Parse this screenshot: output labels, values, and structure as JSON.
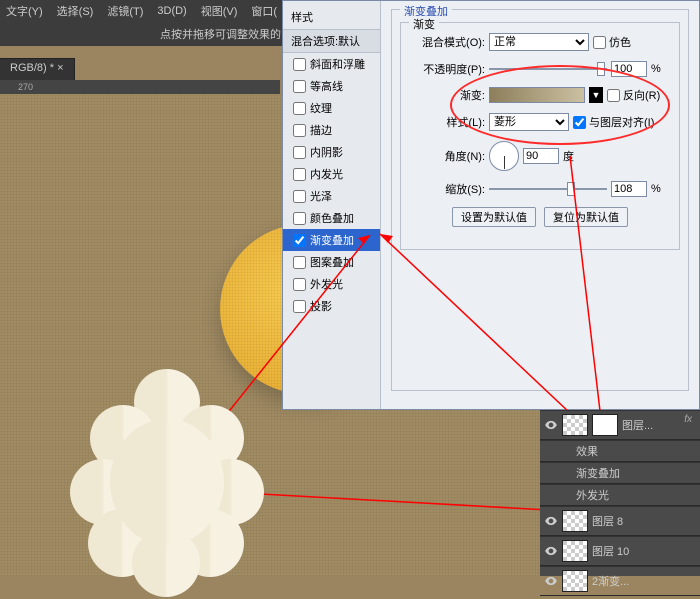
{
  "menubar": {
    "items": [
      "文字(Y)",
      "选择(S)",
      "滤镜(T)",
      "3D(D)",
      "视图(V)",
      "窗口("
    ]
  },
  "options_hint": "点按并拖移可调整效果的",
  "doc_tab": "RGB/8) * ×",
  "ruler": {
    "ticks": [
      "270"
    ]
  },
  "dialog": {
    "styles_title": "样式",
    "blend_title": "混合选项:默认",
    "items": [
      {
        "label": "斜面和浮雕",
        "checked": false
      },
      {
        "label": "等高线",
        "checked": false
      },
      {
        "label": "纹理",
        "checked": false
      },
      {
        "label": "描边",
        "checked": false
      },
      {
        "label": "内阴影",
        "checked": false
      },
      {
        "label": "内发光",
        "checked": false
      },
      {
        "label": "光泽",
        "checked": false
      },
      {
        "label": "颜色叠加",
        "checked": false
      },
      {
        "label": "渐变叠加",
        "checked": true,
        "selected": true
      },
      {
        "label": "图案叠加",
        "checked": false
      },
      {
        "label": "外发光",
        "checked": false
      },
      {
        "label": "投影",
        "checked": false
      }
    ],
    "group_title": "渐变叠加",
    "sub_title": "渐变",
    "blend_mode_label": "混合模式(O):",
    "blend_mode_value": "正常",
    "dither_label": "仿色",
    "opacity_label": "不透明度(P):",
    "opacity_value": "100",
    "percent": "%",
    "gradient_label": "渐变:",
    "reverse_label": "反向(R)",
    "style_label": "样式(L):",
    "style_value": "菱形",
    "align_label": "与图层对齐(I)",
    "angle_label": "角度(N):",
    "angle_value": "90",
    "angle_unit": "度",
    "scale_label": "缩放(S):",
    "scale_value": "108",
    "btn_default": "设置为默认值",
    "btn_reset": "复位为默认值"
  },
  "layers": {
    "fx": "fx",
    "rows": [
      {
        "name": "图层...",
        "has_fx": true
      },
      {
        "name": "效果",
        "sub": true
      },
      {
        "name": "渐变叠加",
        "sub": true
      },
      {
        "name": "外发光",
        "sub": true
      },
      {
        "name": "图层 8"
      },
      {
        "name": "图层 10"
      },
      {
        "name": "2渐变..."
      }
    ]
  }
}
